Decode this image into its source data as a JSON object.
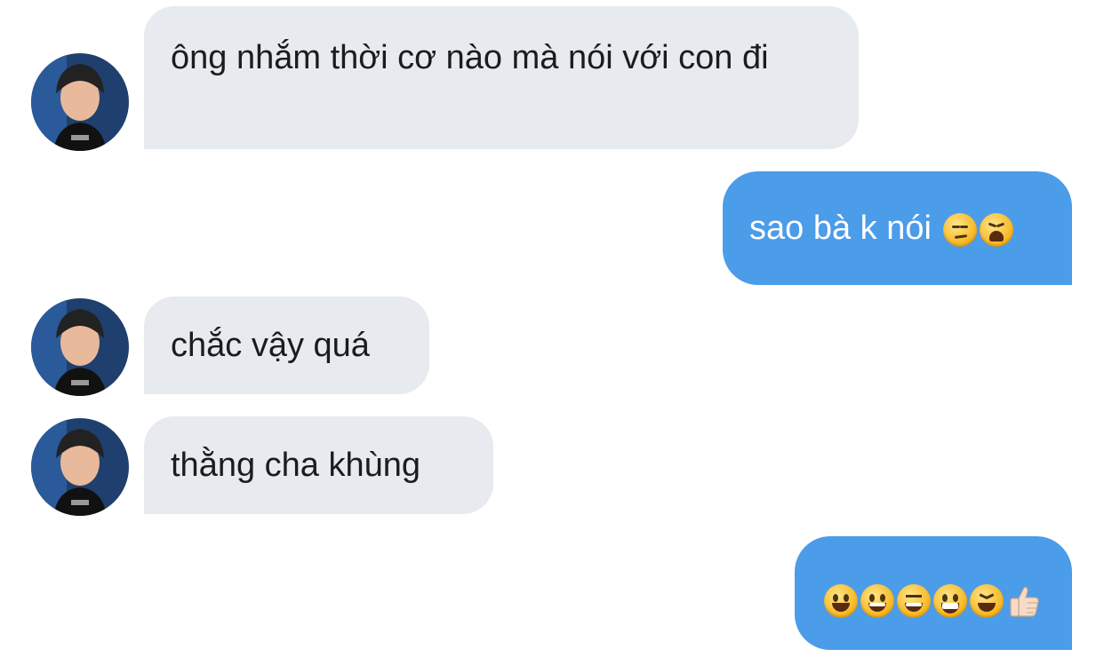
{
  "messages": [
    {
      "direction": "incoming",
      "text": "ông nhắm thời cơ nào mà nói với con đi"
    },
    {
      "direction": "outgoing",
      "text": "sao bà k nói",
      "emoji": [
        "unamused-face-icon",
        "weary-face-icon"
      ]
    },
    {
      "direction": "incoming",
      "text": "chắc vậy quá"
    },
    {
      "direction": "incoming",
      "text": "thằng cha khùng"
    },
    {
      "direction": "outgoing",
      "text": "",
      "emoji": [
        "smiley-face-icon",
        "grinning-face-icon",
        "grinning-smiling-eyes-icon",
        "beaming-face-icon",
        "squinting-face-icon",
        "thumbs-up-icon"
      ]
    }
  ],
  "colors": {
    "incoming_bubble": "#e7eaef",
    "outgoing_bubble": "#4b9ce9",
    "incoming_text": "#1c1c1c",
    "outgoing_text": "#ffffff"
  }
}
